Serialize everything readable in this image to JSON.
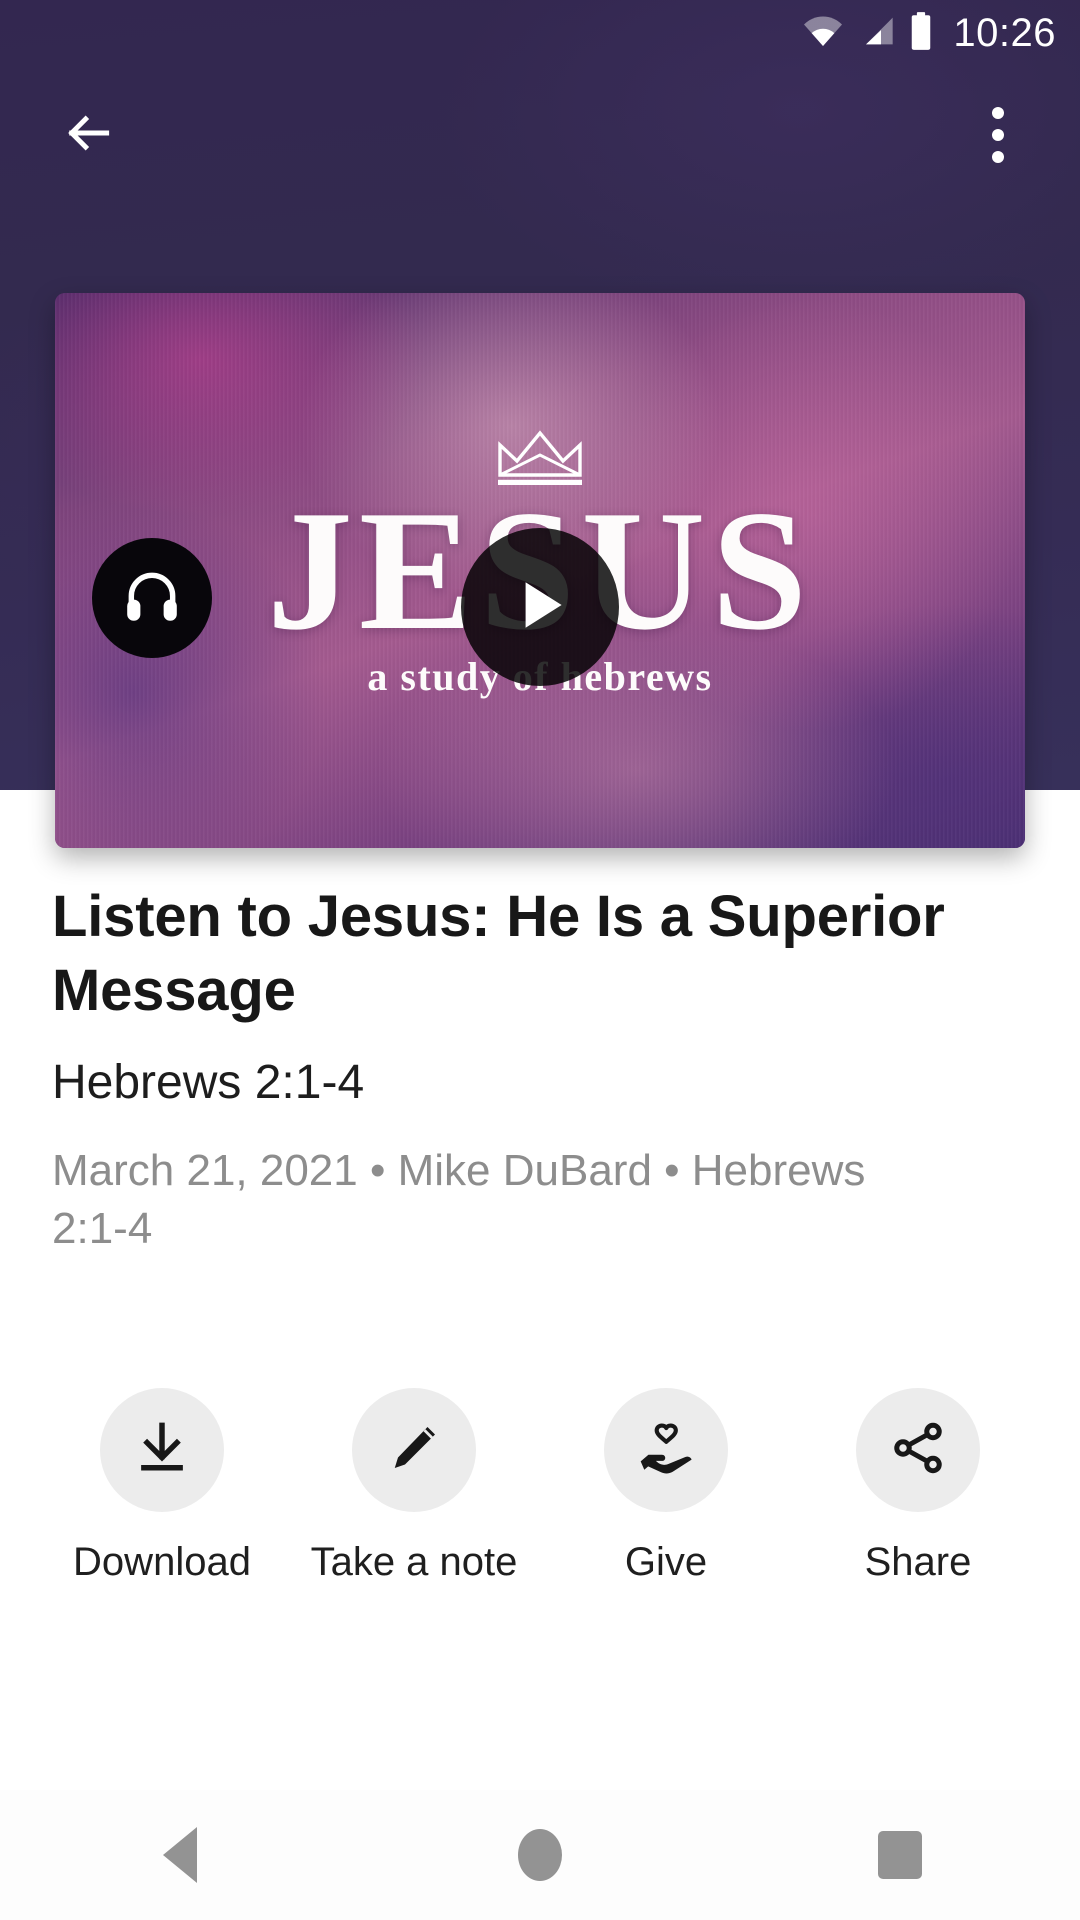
{
  "status_bar": {
    "time": "10:26",
    "icons": [
      "wifi-icon",
      "cellular-signal-icon",
      "battery-icon"
    ]
  },
  "app_bar": {
    "back_icon": "back-arrow-icon",
    "overflow_icon": "overflow-menu-icon"
  },
  "hero": {
    "wordmark": "JESUS",
    "tagline": "a study of hebrews",
    "crown_icon": "crown-icon",
    "play_icon": "play-icon",
    "audio_icon": "headphones-icon"
  },
  "sermon": {
    "title": "Listen to Jesus: He Is a Superior Message",
    "passage": "Hebrews 2:1-4",
    "meta": "March 21, 2021 • Mike DuBard • Hebrews 2:1-4",
    "date": "March 21, 2021",
    "speaker": "Mike DuBard",
    "scripture": "Hebrews 2:1-4"
  },
  "actions": [
    {
      "label": "Download",
      "icon": "download-icon"
    },
    {
      "label": "Take a note",
      "icon": "pencil-icon"
    },
    {
      "label": "Give",
      "icon": "hand-heart-icon"
    },
    {
      "label": "Share",
      "icon": "share-icon"
    }
  ],
  "nav_bar": {
    "back": "android-back-icon",
    "home": "android-home-icon",
    "recents": "android-recents-icon"
  },
  "colors": {
    "header_purple": "#332750",
    "hero_magenta": "#a55b90",
    "action_circle": "#ececec",
    "meta_gray": "#8d8d8d",
    "nav_gray": "#939393"
  }
}
